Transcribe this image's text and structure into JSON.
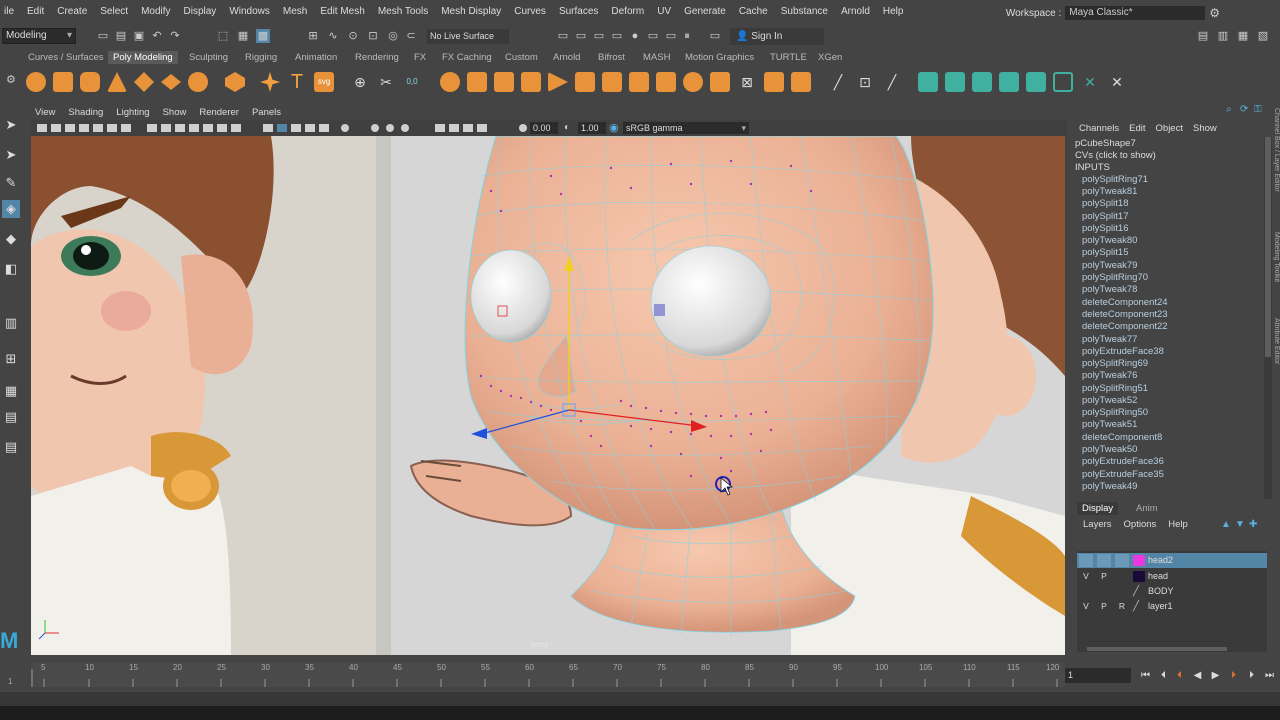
{
  "menubar": {
    "items": [
      "ile",
      "Edit",
      "Create",
      "Select",
      "Modify",
      "Display",
      "Windows",
      "Mesh",
      "Edit Mesh",
      "Mesh Tools",
      "Mesh Display",
      "Curves",
      "Surfaces",
      "Deform",
      "UV",
      "Generate",
      "Cache",
      "Substance",
      "Arnold",
      "Help"
    ],
    "workspace_label": "Workspace :",
    "workspace_value": "Maya Classic*"
  },
  "statusline": {
    "mode": "Modeling",
    "live_surface": "No Live Surface",
    "sign_in": "Sign In"
  },
  "shelf": {
    "tabs": [
      "Curves / Surfaces",
      "Poly Modeling",
      "Sculpting",
      "Rigging",
      "Animation",
      "Rendering",
      "FX",
      "FX Caching",
      "Custom",
      "Arnold",
      "Bifrost",
      "MASH",
      "Motion Graphics",
      "TURTLE",
      "XGen"
    ],
    "active_tab": "Poly Modeling"
  },
  "viewport": {
    "menu": [
      "View",
      "Shading",
      "Lighting",
      "Show",
      "Renderer",
      "Panels"
    ],
    "near_value": "0.00",
    "far_value": "1.00",
    "color_space": "sRGB gamma",
    "camera_label": "persp"
  },
  "channel_box": {
    "menu": [
      "Channels",
      "Edit",
      "Object",
      "Show"
    ],
    "shape_name": "pCubeShape7",
    "cvs_label": "CVs (click to show)",
    "inputs_label": "INPUTS",
    "inputs": [
      "polySplitRing71",
      "polyTweak81",
      "polySplit18",
      "polySplit17",
      "polySplit16",
      "polyTweak80",
      "polySplit15",
      "polyTweak79",
      "polySplitRing70",
      "polyTweak78",
      "deleteComponent24",
      "deleteComponent23",
      "deleteComponent22",
      "polyTweak77",
      "polyExtrudeFace38",
      "polySplitRing69",
      "polyTweak76",
      "polySplitRing51",
      "polyTweak52",
      "polySplitRing50",
      "polyTweak51",
      "deleteComponent8",
      "polyTweak50",
      "polyExtrudeFace36",
      "polyExtrudeFace35",
      "polyTweak49"
    ],
    "side_tabs": [
      "Channel Box / Layer Editor",
      "Modeling Toolkit",
      "Attribute Editor"
    ]
  },
  "layer_editor": {
    "tabs": [
      "Display",
      "Anim"
    ],
    "active_tab": "Display",
    "menu": [
      "Layers",
      "Options",
      "Help"
    ],
    "layers": [
      {
        "v": "",
        "p": "",
        "r": "",
        "name": "head2",
        "color": "#e83ae0",
        "selected": true
      },
      {
        "v": "V",
        "p": "P",
        "r": "",
        "name": "head",
        "color": "#1a0a3a",
        "selected": false
      },
      {
        "v": "",
        "p": "",
        "r": "",
        "name": "BODY",
        "color": "",
        "selected": false
      },
      {
        "v": "V",
        "p": "P",
        "r": "R",
        "name": "layer1",
        "color": "",
        "selected": false
      }
    ]
  },
  "timeslider": {
    "ticks": [
      "5",
      "10",
      "15",
      "20",
      "25",
      "30",
      "35",
      "40",
      "45",
      "50",
      "55",
      "60",
      "65",
      "70",
      "75",
      "80",
      "85",
      "90",
      "95",
      "100",
      "105",
      "110",
      "115",
      "120"
    ],
    "start_marker": "1",
    "current_frame": "1"
  },
  "colors": {
    "ui_bg": "#444444",
    "field_bg": "#2b2b2b",
    "selection": "#5285a6",
    "skin": "#f0b89a",
    "wire": "#7fd6e8"
  }
}
